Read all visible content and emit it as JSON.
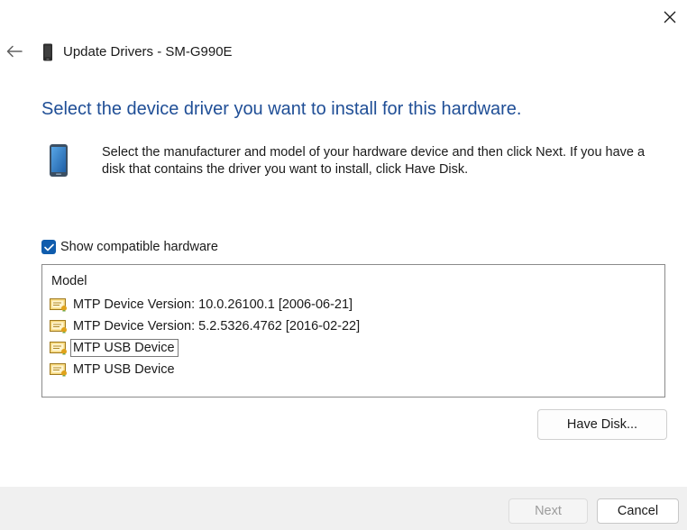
{
  "window": {
    "title": "Update Drivers - SM-G990E"
  },
  "heading": "Select the device driver you want to install for this hardware.",
  "description": "Select the manufacturer and model of your hardware device and then click Next. If you have a disk that contains the driver you want to install, click Have Disk.",
  "compatible": {
    "label": "Show compatible hardware",
    "checked": true
  },
  "model_list": {
    "header": "Model",
    "items": [
      {
        "label": "MTP Device Version: 10.0.26100.1 [2006-06-21]",
        "icon": "driver-certificate-icon"
      },
      {
        "label": "MTP Device Version: 5.2.5326.4762 [2016-02-22]",
        "icon": "driver-certificate-icon"
      },
      {
        "label": "MTP USB Device",
        "icon": "driver-certificate-icon",
        "focused": true
      },
      {
        "label": "MTP USB Device",
        "icon": "driver-certificate-icon"
      }
    ]
  },
  "buttons": {
    "have_disk": "Have Disk...",
    "next": "Next",
    "cancel": "Cancel"
  },
  "colors": {
    "heading": "#1f4e96",
    "checkbox_accent": "#0f5cad",
    "footer_bg": "#f0f0f0"
  }
}
